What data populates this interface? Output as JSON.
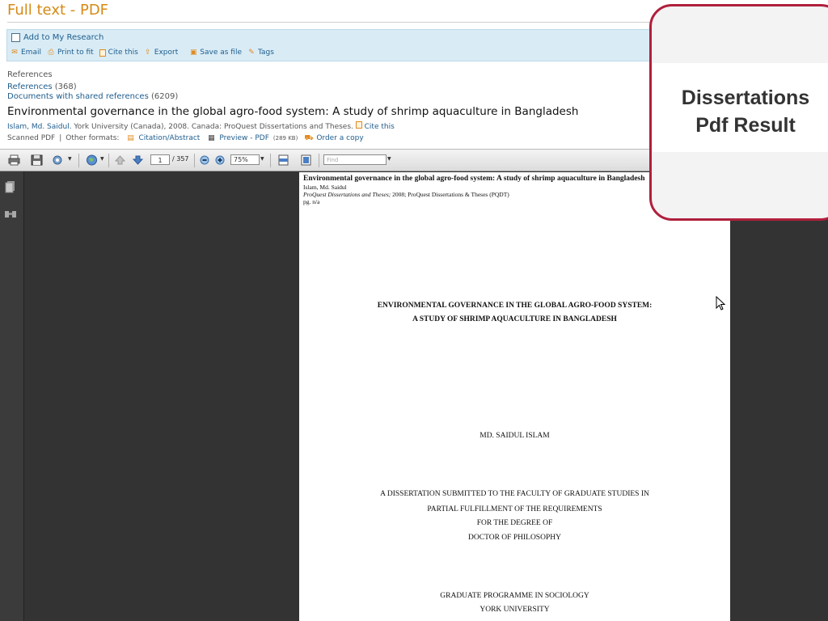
{
  "page": {
    "title": "Full text - PDF"
  },
  "actions": {
    "add_research": "Add to My Research",
    "tools": {
      "email": "Email",
      "print": "Print to fit",
      "cite": "Cite this",
      "export": "Export",
      "save": "Save as file",
      "tags": "Tags"
    }
  },
  "refs": {
    "heading": "References",
    "references_link": "References",
    "references_count": "(368)",
    "shared_link": "Documents with shared references",
    "shared_count": "(6209)"
  },
  "doc": {
    "title": "Environmental governance in the global agro-food system: A study of shrimp aquaculture in Bangladesh",
    "author": "Islam, Md. Saidul.",
    "source": " York University (Canada), 2008. Canada: ProQuest Dissertations and Theses.",
    "cite": "Cite this",
    "scanned": "Scanned PDF",
    "sep": "|",
    "other_formats": "Other formats:",
    "citation_abstract": "Citation/Abstract",
    "preview": "Preview - PDF",
    "preview_size": "(289 KB)",
    "order": "Order a copy"
  },
  "pdf_toolbar": {
    "page_current": "1",
    "page_total": "/ 357",
    "zoom": "75%",
    "find_placeholder": "Find"
  },
  "pdf_page": {
    "header_title": "Environmental governance in the global agro-food system: A study of shrimp aquaculture in Bangladesh",
    "header_author": "Islam, Md. Saidul",
    "header_source_italic": "ProQuest Dissertations and Theses;",
    "header_source_rest": " 2008; ProQuest Dissertations & Theses (PQDT)",
    "header_pg": "pg. n/a",
    "title_line1": "ENVIRONMENTAL GOVERNANCE IN THE GLOBAL AGRO-FOOD SYSTEM:",
    "title_line2": "A STUDY OF SHRIMP AQUACULTURE IN BANGLADESH",
    "author": "MD. SAIDUL ISLAM",
    "diss_line1": "A DISSERTATION SUBMITTED TO THE FACULTY OF GRADUATE STUDIES IN",
    "diss_line2": "PARTIAL FULFILLMENT OF THE REQUIREMENTS",
    "diss_line3": "FOR THE DEGREE OF",
    "diss_line4": "DOCTOR OF PHILOSOPHY",
    "prog_line1": "GRADUATE PROGRAMME IN SOCIOLOGY",
    "prog_line2": "YORK UNIVERSITY"
  },
  "callout": {
    "line1": "Dissertations",
    "line2": "Pdf Result"
  },
  "colors": {
    "title_orange": "#d68a14",
    "link_blue": "#1f5d8c",
    "callout_border": "#b01f3c",
    "viewer_bg": "#333333"
  }
}
